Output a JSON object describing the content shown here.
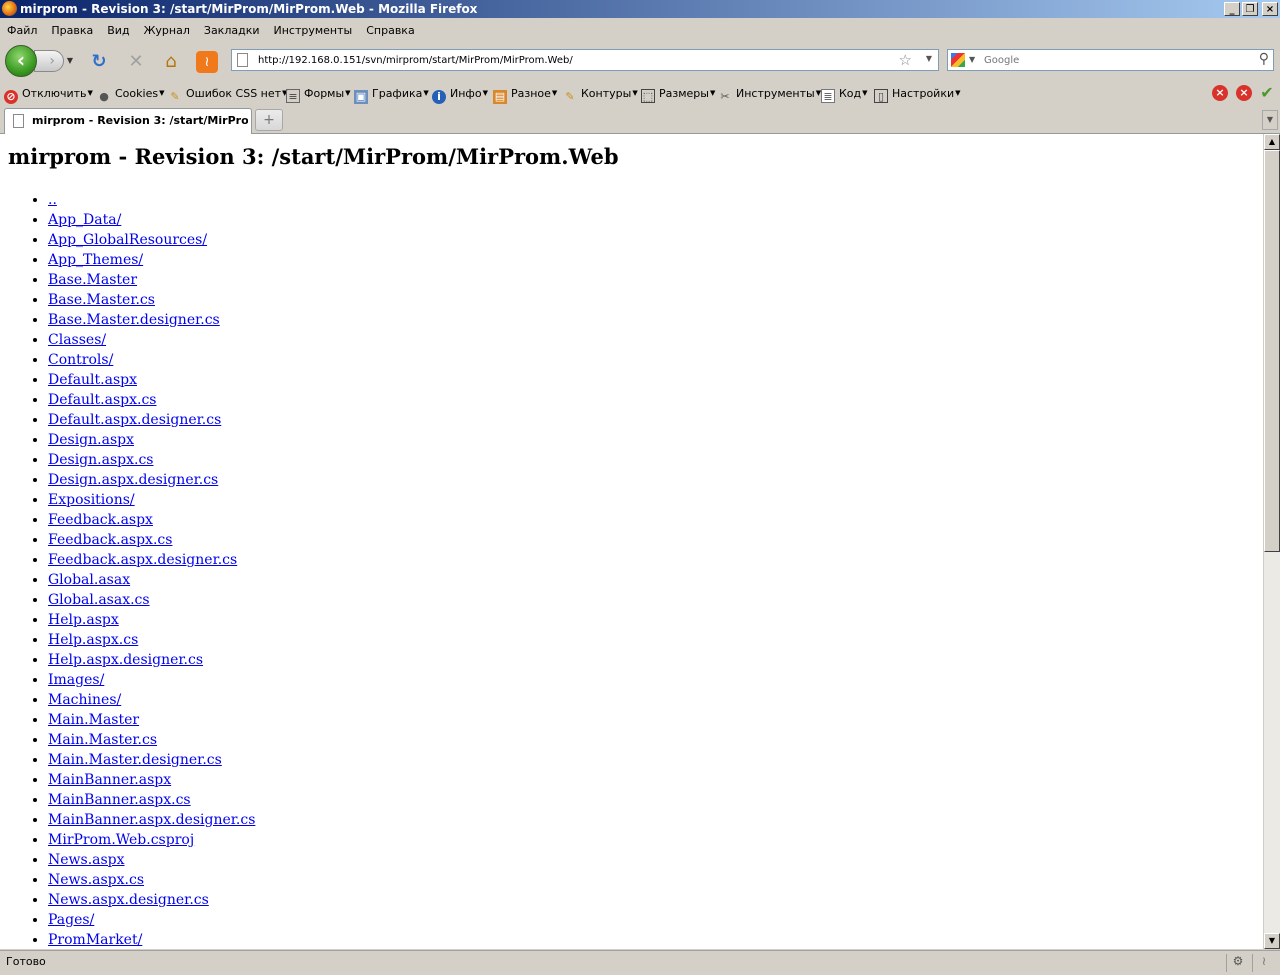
{
  "window": {
    "title": "mirprom - Revision 3: /start/MirProm/MirProm.Web - Mozilla Firefox",
    "buttons": {
      "minimize": "_",
      "maximize": "❐",
      "close": "×"
    }
  },
  "menu": [
    "Файл",
    "Правка",
    "Вид",
    "Журнал",
    "Закладки",
    "Инструменты",
    "Справка"
  ],
  "nav": {
    "url": "http://192.168.0.151/svn/mirprom/start/MirProm/MirProm.Web/",
    "search_placeholder": "Google"
  },
  "dev_toolbar": {
    "items": [
      "Отключить",
      "Cookies",
      "Ошибок CSS нет",
      "Формы",
      "Графика",
      "Инфо",
      "Разное",
      "Контуры",
      "Размеры",
      "Инструменты",
      "Код",
      "Настройки"
    ]
  },
  "tabs": [
    {
      "label": "mirprom - Revision 3: /start/MirProm/MirProm.Web"
    }
  ],
  "page": {
    "heading": "mirprom - Revision 3: /start/MirProm/MirProm.Web",
    "links": [
      "..",
      "App_Data/",
      "App_GlobalResources/",
      "App_Themes/",
      "Base.Master",
      "Base.Master.cs",
      "Base.Master.designer.cs",
      "Classes/",
      "Controls/",
      "Default.aspx",
      "Default.aspx.cs",
      "Default.aspx.designer.cs",
      "Design.aspx",
      "Design.aspx.cs",
      "Design.aspx.designer.cs",
      "Expositions/",
      "Feedback.aspx",
      "Feedback.aspx.cs",
      "Feedback.aspx.designer.cs",
      "Global.asax",
      "Global.asax.cs",
      "Help.aspx",
      "Help.aspx.cs",
      "Help.aspx.designer.cs",
      "Images/",
      "Machines/",
      "Main.Master",
      "Main.Master.cs",
      "Main.Master.designer.cs",
      "MainBanner.aspx",
      "MainBanner.aspx.cs",
      "MainBanner.aspx.designer.cs",
      "MirProm.Web.csproj",
      "News.aspx",
      "News.aspx.cs",
      "News.aspx.designer.cs",
      "Pages/",
      "PromMarket/"
    ]
  },
  "status": {
    "text": "Готово"
  }
}
